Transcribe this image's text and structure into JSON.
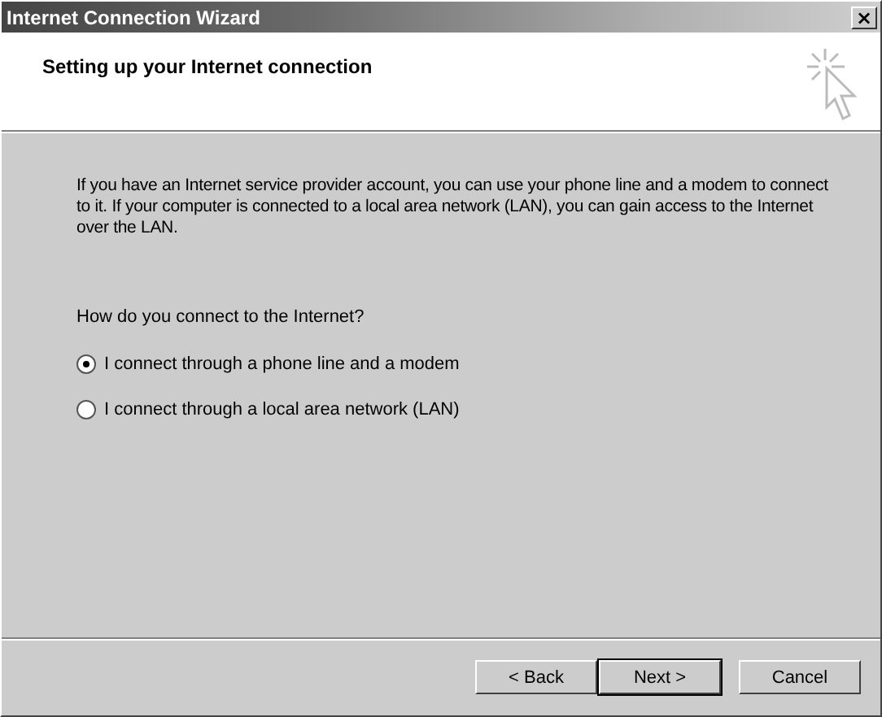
{
  "window": {
    "title": "Internet Connection Wizard",
    "close_button": "×"
  },
  "header": {
    "title": "Setting up your Internet connection"
  },
  "intro": "If you have an Internet service provider account, you can use your phone line and a modem to connect to it. If your computer is connected to a local area network (LAN), you can gain access to the Internet over the LAN.",
  "question": "How do you connect to the Internet?",
  "options": [
    {
      "label": "I connect through a phone line and a modem",
      "selected": true
    },
    {
      "label": "I connect through a local area network (LAN)",
      "selected": false
    }
  ],
  "buttons": [
    {
      "label": "< Back",
      "default": false
    },
    {
      "label": "Next >",
      "default": true
    },
    {
      "label": "Cancel",
      "default": false
    }
  ]
}
